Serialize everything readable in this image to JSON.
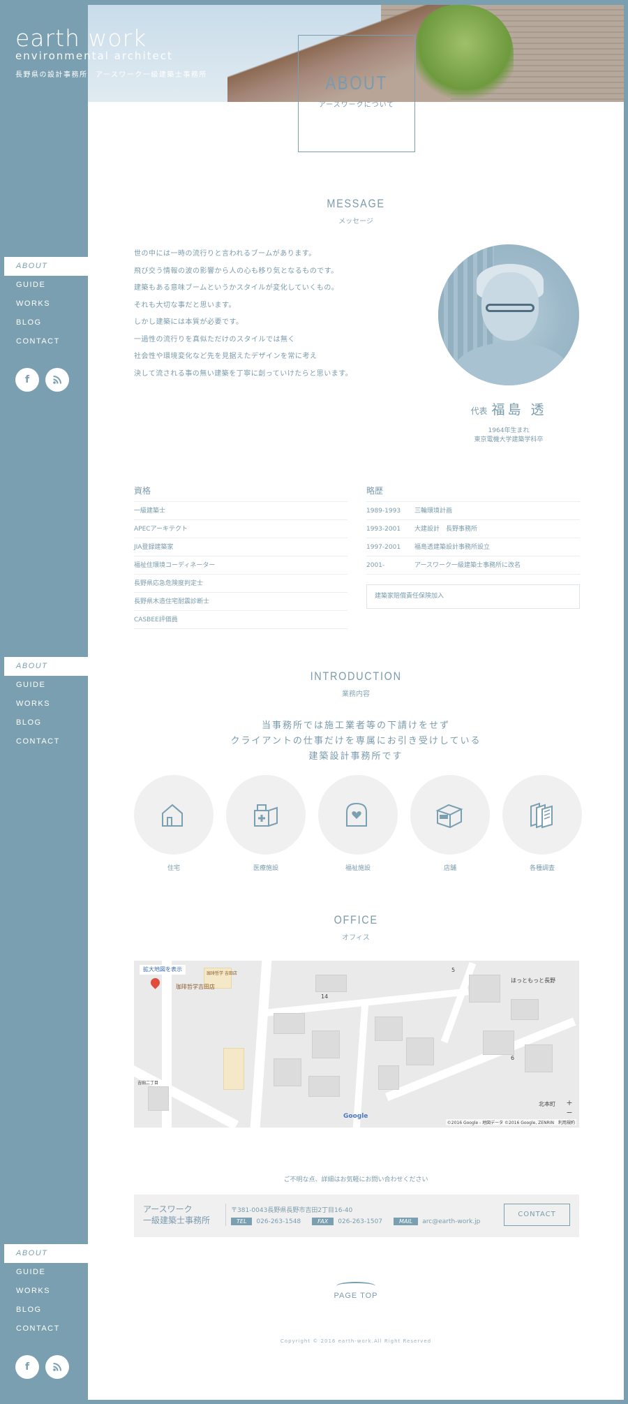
{
  "site": {
    "logo_line1": "earth work",
    "logo_line2": "environmental architect",
    "logo_tagline": "長野県の設計事務所　アースワーク一級建築士事務所"
  },
  "nav": {
    "items": [
      "ABOUT",
      "GUIDE",
      "WORKS",
      "BLOG",
      "CONTACT"
    ],
    "active": "ABOUT"
  },
  "social": {
    "facebook": "f",
    "rss": "rss-icon"
  },
  "hero": {
    "title_en": "ABOUT",
    "title_jp": "アースワークについて"
  },
  "message": {
    "title_en": "MESSAGE",
    "title_jp": "メッセージ",
    "lines": [
      "世の中には一時の流行りと言われるブームがあります。",
      "飛び交う情報の波の影響から人の心も移り気となるものです。",
      "建築もある意味ブームというかスタイルが変化していくもの。",
      "それも大切な事だと思います。",
      "しかし建築には本質が必要です。",
      "一過性の流行りを真似ただけのスタイルでは無く",
      "社会性や環境変化など先を見据えたデザインを常に考え",
      "決して流される事の無い建築を丁寧に創っていけたらと思います。"
    ],
    "rep_role": "代表",
    "rep_name": "福島 透",
    "rep_born": "1964年生まれ",
    "rep_school": "東京電機大学建築学科卒"
  },
  "qualifications": {
    "title": "資格",
    "items": [
      "一級建築士",
      "APECアーキテクト",
      "JIA登録建築家",
      "福祉住環境コーディネーター",
      "長野県応急危険度判定士",
      "長野県木造住宅耐震診断士",
      "CASBEE評価員"
    ]
  },
  "history": {
    "title": "略歴",
    "items": [
      {
        "year": "1989-1993",
        "text": "三輪環境計画"
      },
      {
        "year": "1993-2001",
        "text": "大建設計　長野事務所"
      },
      {
        "year": "1997-2001",
        "text": "福島透建築設計事務所設立"
      },
      {
        "year": "2001-",
        "text": "アースワーク一級建築士事務所に改名"
      }
    ],
    "note": "建築家賠償責任保険加入"
  },
  "introduction": {
    "title_en": "INTRODUCTION",
    "title_jp": "業務内容",
    "text": [
      "当事務所では施工業者等の下請けをせず",
      "クライアントの仕事だけを専属にお引き受けしている",
      "建築設計事務所です"
    ],
    "services": [
      "住宅",
      "医療施設",
      "福祉施設",
      "店舗",
      "各種調査"
    ]
  },
  "office": {
    "title_en": "OFFICE",
    "title_jp": "オフィス",
    "map": {
      "enlarge_label": "拡大地図を表示",
      "place_label": "珈琲哲学吉田店",
      "place_label2": "珈琲哲学 吉田店",
      "label_hottomotto": "ほっともっと長野",
      "label_kitahonmachi": "北本町",
      "label_14": "14",
      "label_5": "5",
      "label_6": "6",
      "label_yoshida2": "吉田二丁目",
      "label_google": "Google",
      "credit": "©2016 Google - 地図データ ©2016 Google, ZENRIN　利用規約",
      "zoom_in": "+",
      "zoom_out": "−"
    }
  },
  "contact": {
    "inquiry": "ご不明な点、詳細はお気軽にお問い合わせください",
    "company_line1": "アースワーク",
    "company_line2": "一級建築士事務所",
    "address": "〒381-0043長野県長野市吉田2丁目16-40",
    "tel_label": "TEL",
    "tel": "026-263-1548",
    "fax_label": "FAX",
    "fax": "026-263-1507",
    "mail_label": "MAIL",
    "mail": "arc@earth-work.jp",
    "button": "CONTACT"
  },
  "footer": {
    "page_top": "PAGE TOP",
    "copyright": "Copyright © 2016 earth-work.All Right Reserved"
  }
}
